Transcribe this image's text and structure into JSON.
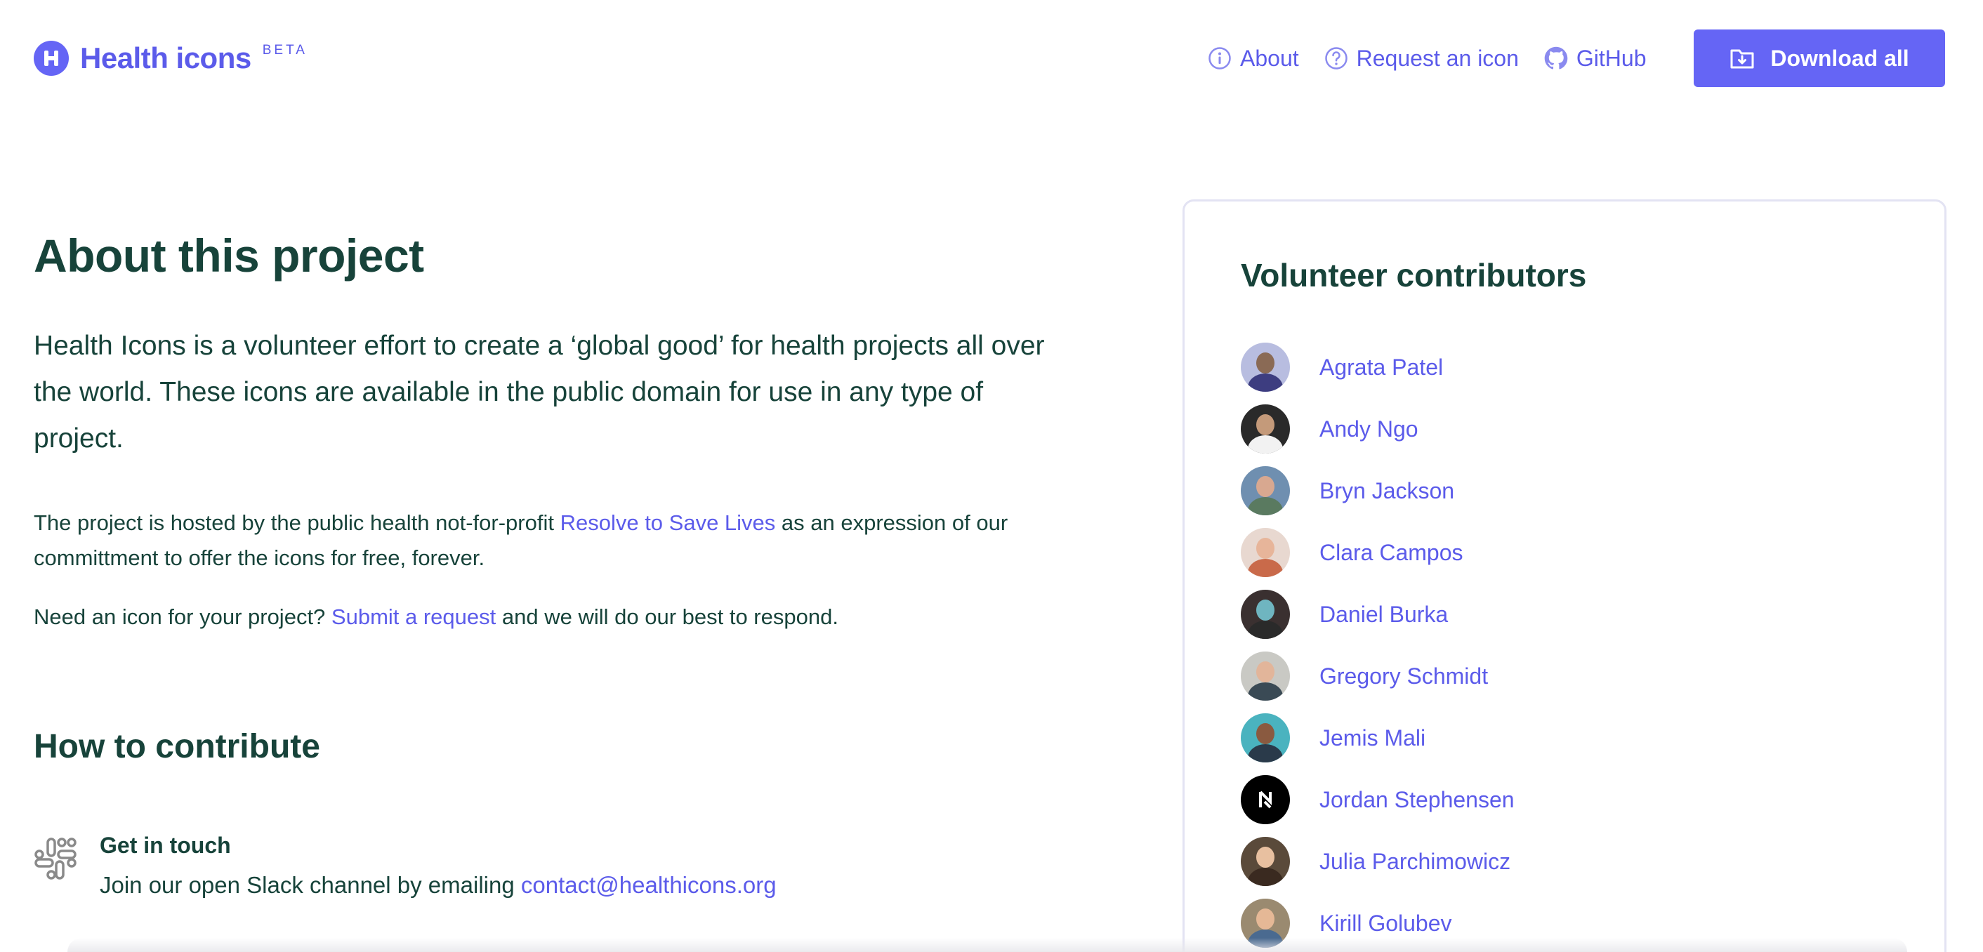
{
  "brand": {
    "name": "Health icons",
    "badge": "BETA",
    "logo_letter": "H",
    "color": "#6565f5"
  },
  "nav": {
    "about": "About",
    "request": "Request an icon",
    "github": "GitHub",
    "download": "Download all"
  },
  "about": {
    "title": "About this project",
    "lead": "Health Icons is a volunteer effort to create a ‘global good’ for health projects all over the world. These icons are available in the public domain for use in any type of project.",
    "hosted_before": "The project is hosted by the public health not-for-profit ",
    "hosted_link": "Resolve to Save Lives",
    "hosted_after": " as an expression of our committment to offer the icons for free, forever.",
    "need_before": "Need an icon for your project? ",
    "need_link": "Submit a request",
    "need_after": " and we will do our best to respond."
  },
  "contribute": {
    "title": "How to contribute",
    "items": [
      {
        "heading": "Get in touch",
        "text": "Join our open Slack channel by emailing ",
        "link": "contact@healthicons.org",
        "icon": "slack-icon"
      }
    ]
  },
  "contributors": {
    "title": "Volunteer contributors",
    "people": [
      {
        "name": "Agrata Patel",
        "bg": "#b8bde0",
        "skin": "#8a6a55",
        "shirt": "#3d3d80"
      },
      {
        "name": "Andy Ngo",
        "bg": "#2a2a2a",
        "skin": "#c49a7a",
        "shirt": "#f2f2f2"
      },
      {
        "name": "Bryn Jackson",
        "bg": "#6f8fb0",
        "skin": "#d8a890",
        "shirt": "#5a7a60"
      },
      {
        "name": "Clara Campos",
        "bg": "#e8d8d0",
        "skin": "#e7b59a",
        "shirt": "#c96a4a"
      },
      {
        "name": "Daniel Burka",
        "bg": "#3a3030",
        "skin": "#6fb5c0",
        "shirt": "#2a2a2a"
      },
      {
        "name": "Gregory Schmidt",
        "bg": "#c9c9c4",
        "skin": "#e2b59a",
        "shirt": "#3a4a55"
      },
      {
        "name": "Jemis Mali",
        "bg": "#4ab3bf",
        "skin": "#8a5a40",
        "shirt": "#2a3a4a"
      },
      {
        "name": "Jordan Stephensen",
        "bg": "#000000",
        "skin": "#000000",
        "shirt": "#000000"
      },
      {
        "name": "Julia Parchimowicz",
        "bg": "#5a4a3a",
        "skin": "#e8c0a0",
        "shirt": "#3a2a20"
      },
      {
        "name": "Kirill Golubev",
        "bg": "#9a8a70",
        "skin": "#e5b896",
        "shirt": "#4a6a90"
      }
    ]
  }
}
